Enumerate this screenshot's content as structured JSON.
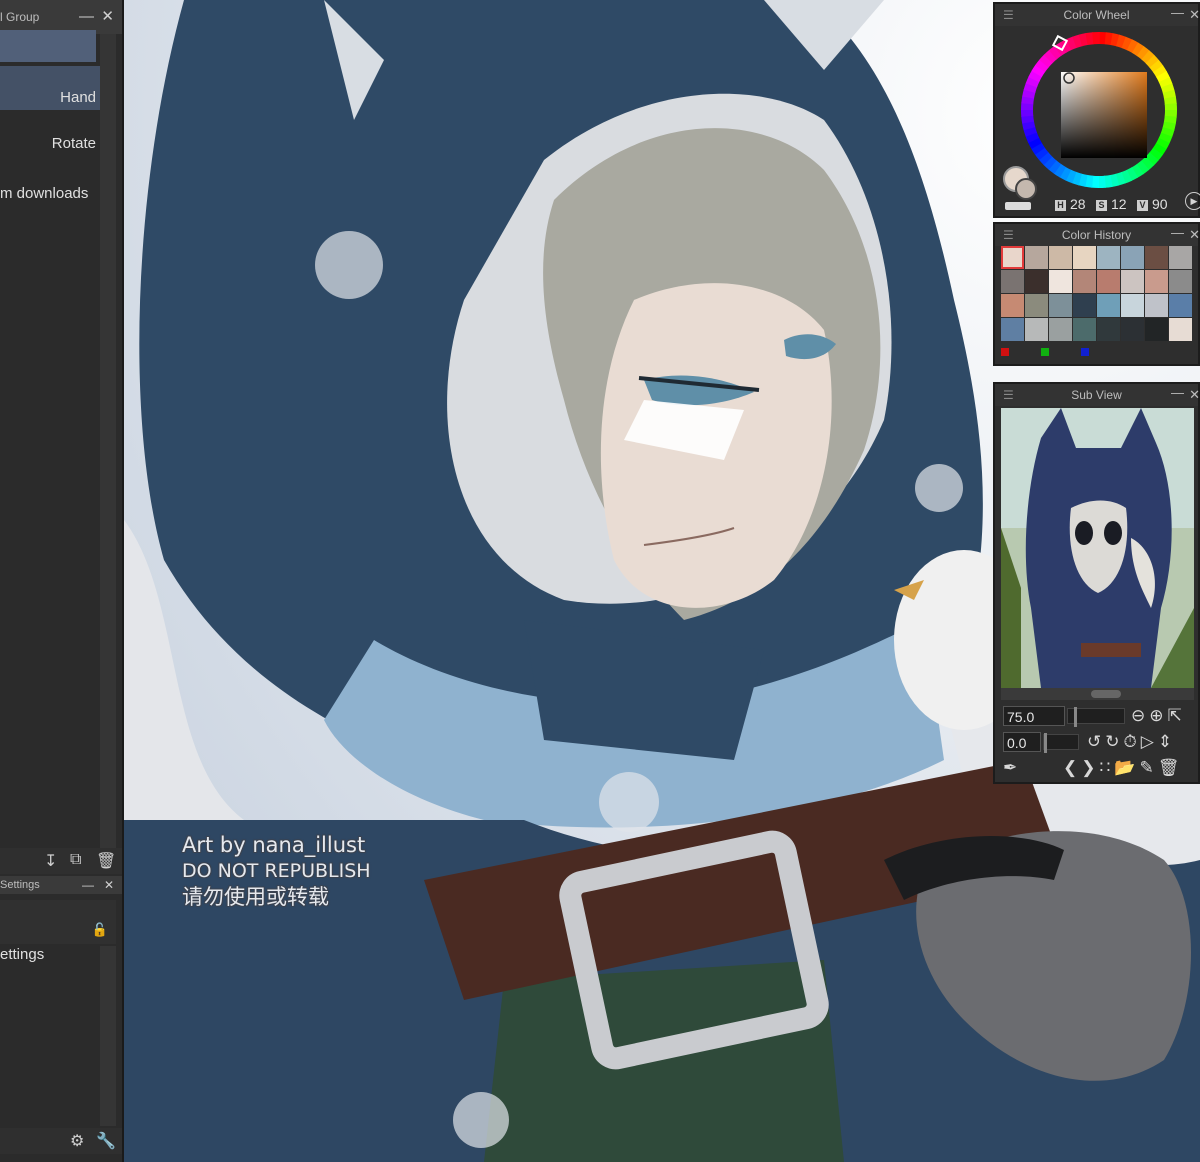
{
  "tool_group": {
    "title": "l Group",
    "items": [
      {
        "label": ""
      },
      {
        "label": "Hand"
      },
      {
        "label": "Rotate"
      },
      {
        "label": "m downloads"
      }
    ]
  },
  "tool_settings": {
    "title": "Settings",
    "label": "ettings"
  },
  "color_wheel": {
    "title": "Color Wheel",
    "h_label": "H",
    "h_value": "28",
    "s_label": "S",
    "s_value": "12",
    "v_label": "V",
    "v_value": "90",
    "main_color": "#e6d8cc",
    "sub_color": "#c4b8ae"
  },
  "color_history": {
    "title": "Color History",
    "swatches": [
      "#e9d6cb",
      "#b6a79d",
      "#cdb9a6",
      "#e7d5c1",
      "#9db4c1",
      "#8aa3b6",
      "#6b4e43",
      "#a8a6a5",
      "#7a7371",
      "#3b2f2c",
      "#efe5de",
      "#b38678",
      "#b87c6e",
      "#ccc4c1",
      "#c99b8d",
      "#8b8b8b",
      "#c68a73",
      "#8b8b7d",
      "#7d9099",
      "#2f3f4f",
      "#6f9fb8",
      "#c8d5dc",
      "#bfc2c9",
      "#5a7ea8",
      "#5f7fa3",
      "#b7b9b9",
      "#9aa0a0",
      "#4c6b6b",
      "#30393c",
      "#2c3034",
      "#222526",
      "#e7dcd4"
    ],
    "palette": [
      "#d01010",
      "#10b010",
      "#1020d0"
    ]
  },
  "sub_view": {
    "title": "Sub View",
    "zoom": "75.0",
    "rotation": "0.0"
  },
  "artwork": {
    "watermark_line1": "Art by nana_illust",
    "watermark_line2": "DO NOT REPUBLISH",
    "watermark_line3": "请勿使用或转载"
  }
}
